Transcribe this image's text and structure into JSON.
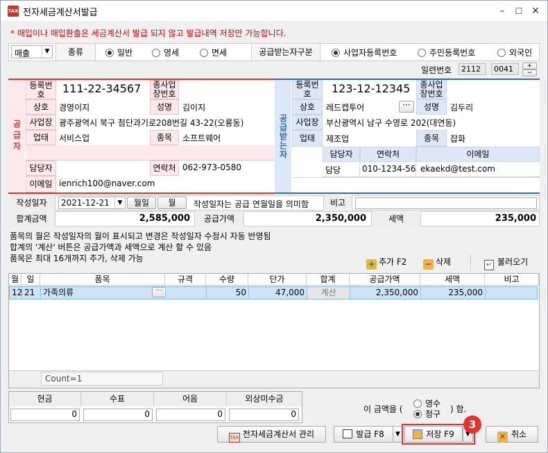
{
  "window": {
    "title": "전자세금계산서발급",
    "minimize": "–",
    "maximize": "☐",
    "close": "✕"
  },
  "notice": "* 매입이나 매입환출은 세금계산서 발급 되지 않고 발급내역 저장만 가능합니다.",
  "options": {
    "trade_type": "매출",
    "kind_label": "종류",
    "kind_options": [
      "일반",
      "영세",
      "면세"
    ],
    "kind_selected": "일반",
    "recv_label": "공급받는자구분",
    "recv_options": [
      "사업자등록번호",
      "주민등록번호",
      "외국인"
    ],
    "recv_selected": "사업자등록번호"
  },
  "serial": {
    "label": "일련번호",
    "part1": "2112",
    "part2": "0041",
    "up": "+",
    "down": "−"
  },
  "supplier": {
    "side_label": "공급자",
    "reg_label": "등록번호",
    "reg_no": "111-22-34567",
    "sub_label": "종사업장번호",
    "sub_value": "",
    "name_label": "상호",
    "name": "경영이지",
    "rep_label": "성명",
    "rep": "김이지",
    "addr_label": "사업장",
    "addr": "광주광역시 북구 첨단과기로208번길 43-22(오룡동)",
    "biz_label": "업태",
    "biz": "서비스업",
    "item_label": "종목",
    "item": "소프트웨어",
    "contact_label": "담당자",
    "contact": "",
    "phone_label": "연락처",
    "phone": "062-973-0580",
    "email_label": "이메일",
    "email": "ienrich100@naver.com"
  },
  "receiver": {
    "side_label": "공급받는자",
    "reg_label": "등록번호",
    "reg_no": "123-12-12345",
    "sub_label": "종사업장번호",
    "sub_value": "",
    "name_label": "상호",
    "name": "레드캡투어",
    "rep_label": "성명",
    "rep": "김두리",
    "addr_label": "사업장",
    "addr": "부산광역시 남구 수영로 202(대연동)",
    "biz_label": "업태",
    "biz": "제조업",
    "item_label": "종목",
    "item": "잡화",
    "contact_head": "담당자",
    "phone_head": "연락처",
    "email_head": "이메일",
    "contact": "담당",
    "phone": "010-1234-5678",
    "email": "ekaekd@test.com"
  },
  "date": {
    "label": "작성일자",
    "value": "2021-12-21",
    "month_day_btn": "월일",
    "month_btn": "월",
    "hint": "작성일자는 공급 연월일을 의미함",
    "remark_label": "비고",
    "remark": ""
  },
  "totals": {
    "total_label": "합계금액",
    "total": "2,585,000",
    "supply_label": "공급가액",
    "supply": "2,350,000",
    "tax_label": "세액",
    "tax": "235,000"
  },
  "notes": [
    "품목의 월은 작성일자의 월이 표시되고 변경은 작성일자 수정시 자동 반영됨",
    "합계의 '계산' 버튼은 공급가액과 세액으로 계산 할 수 있음",
    "품목은 최대 16개까지 추가, 삭제 가능"
  ],
  "toolbar": {
    "add": "추가 F2",
    "delete": "삭제",
    "load": "불러오기"
  },
  "grid": {
    "headers": [
      "월",
      "일",
      "품목",
      "규격",
      "수량",
      "단가",
      "합계",
      "공급가액",
      "세액",
      "비고"
    ],
    "rows": [
      {
        "month": "12",
        "day": "21",
        "item": "가족의류",
        "spec": "",
        "qty": "50",
        "price": "47,000",
        "sum": "계산",
        "supply": "2,350,000",
        "tax": "235,000",
        "note": ""
      }
    ],
    "count": "Count=1"
  },
  "payment": {
    "headers": [
      "현금",
      "수표",
      "어음",
      "외상미수금"
    ],
    "values": [
      "0",
      "0",
      "0",
      "0"
    ],
    "phrase_pre": "이 금액을 (",
    "phrase_post": ") 함.",
    "opt_receipt": "영수",
    "opt_claim": "청구",
    "selected": "청구"
  },
  "buttons": {
    "manage": "전자세금계산서 관리",
    "issue": "발급 F8",
    "save": "저장 F9",
    "cancel": "취소",
    "step_badge": "3"
  },
  "colors": {
    "supplier_accent": "#e0352b",
    "receiver_accent": "#2f6bb5",
    "badge": "#e0352b",
    "selected_row": "#cde4f7"
  }
}
